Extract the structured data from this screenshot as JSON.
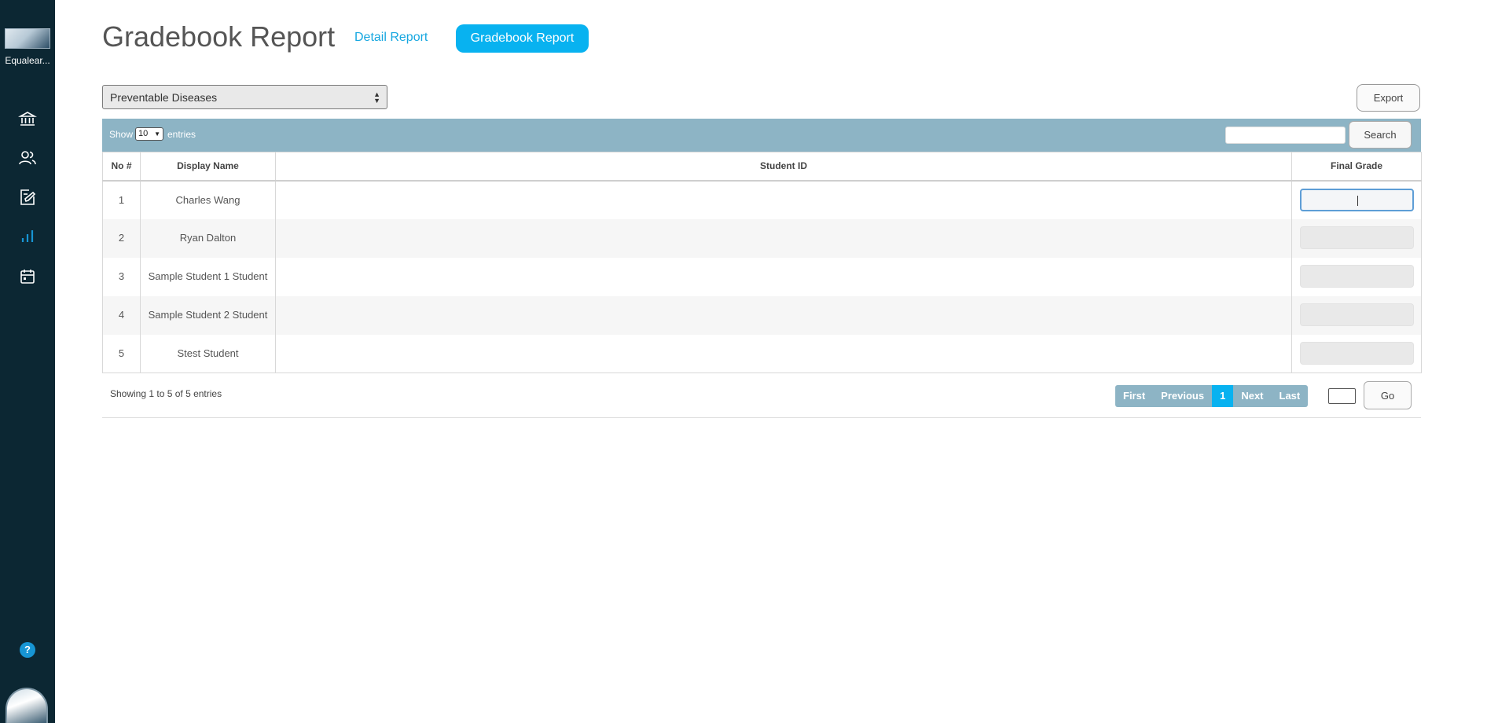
{
  "sidebar": {
    "logo_label": "Equalear...",
    "help_label": "?",
    "items": [
      {
        "name": "institution-icon"
      },
      {
        "name": "users-icon"
      },
      {
        "name": "assignments-icon"
      },
      {
        "name": "reports-icon"
      },
      {
        "name": "calendar-icon"
      }
    ],
    "active_color": "#1795d4"
  },
  "header": {
    "title": "Gradebook Report",
    "detail_report_label": "Detail Report",
    "gradebook_report_label": "Gradebook Report",
    "accent_color": "#08b2f0"
  },
  "controls": {
    "course_selected": "Preventable Diseases",
    "export_label": "Export"
  },
  "toolbar": {
    "show_label": "Show",
    "entries_value": "10",
    "entries_label": "entries",
    "search_label": "Search",
    "bar_color": "#8db4c5"
  },
  "table": {
    "columns": [
      "No #",
      "Display Name",
      "Student ID",
      "Final Grade"
    ],
    "rows": [
      {
        "no": "1",
        "display_name": "Charles Wang",
        "student_id": "",
        "final_grade": ""
      },
      {
        "no": "2",
        "display_name": "Ryan Dalton",
        "student_id": "",
        "final_grade": ""
      },
      {
        "no": "3",
        "display_name": "Sample Student 1 Student",
        "student_id": "",
        "final_grade": ""
      },
      {
        "no": "4",
        "display_name": "Sample Student 2 Student",
        "student_id": "",
        "final_grade": ""
      },
      {
        "no": "5",
        "display_name": "Stest Student",
        "student_id": "",
        "final_grade": ""
      }
    ]
  },
  "footer": {
    "showing": "Showing 1 to 5 of 5 entries",
    "pager": {
      "first": "First",
      "previous": "Previous",
      "current": "1",
      "next": "Next",
      "last": "Last"
    },
    "go_label": "Go"
  }
}
